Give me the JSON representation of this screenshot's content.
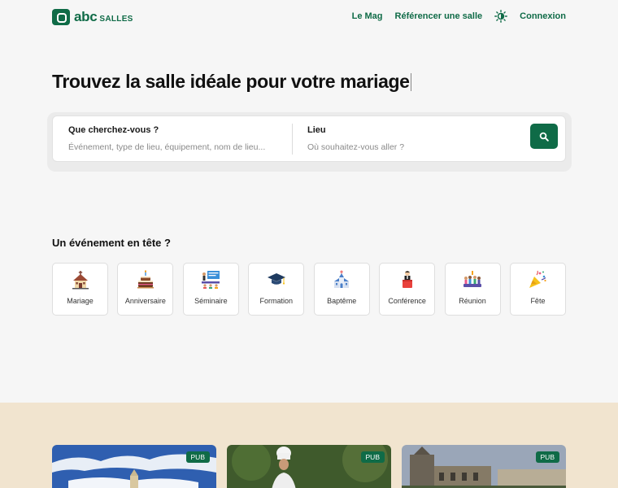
{
  "header": {
    "logo_abc": "abc",
    "logo_salles": "SALLES",
    "nav": {
      "mag": "Le Mag",
      "referencer": "Référencer une salle",
      "connexion": "Connexion"
    }
  },
  "hero": {
    "title": "Trouvez la salle idéale pour votre mariage"
  },
  "search": {
    "what_label": "Que cherchez-vous ?",
    "what_placeholder": "Événement, type de lieu, équipement, nom de lieu...",
    "where_label": "Lieu",
    "where_placeholder": "Où souhaitez-vous aller ?"
  },
  "events": {
    "title": "Un événement en tête ?",
    "items": [
      {
        "label": "Mariage",
        "icon": "chapel-icon"
      },
      {
        "label": "Anniversaire",
        "icon": "cake-icon"
      },
      {
        "label": "Séminaire",
        "icon": "presentation-icon"
      },
      {
        "label": "Formation",
        "icon": "graduation-cap-icon"
      },
      {
        "label": "Baptême",
        "icon": "church-icon"
      },
      {
        "label": "Conférence",
        "icon": "speaker-icon"
      },
      {
        "label": "Réunion",
        "icon": "meeting-icon"
      },
      {
        "label": "Fête",
        "icon": "party-popper-icon"
      }
    ]
  },
  "ads": [
    {
      "badge": "PUB"
    },
    {
      "badge": "PUB"
    },
    {
      "badge": "PUB"
    }
  ],
  "colors": {
    "brand": "#0f6b47",
    "beige": "#f1e4cf"
  }
}
